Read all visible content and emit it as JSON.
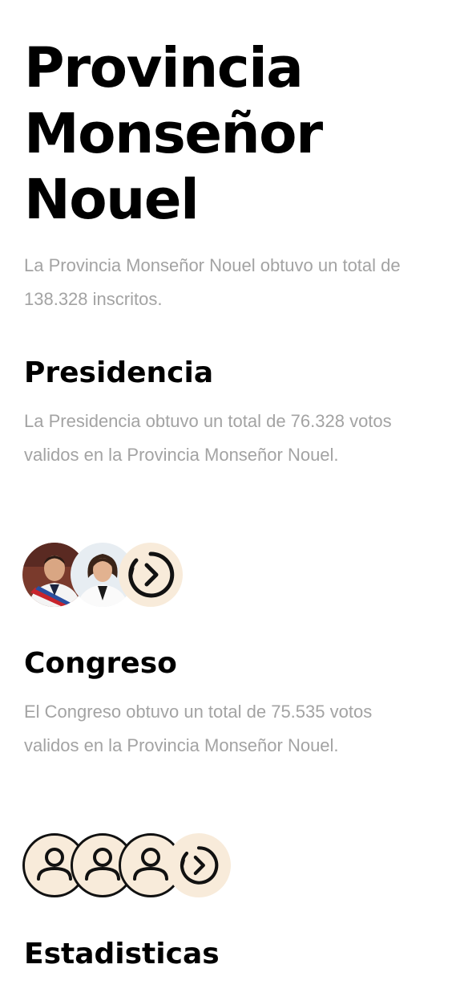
{
  "header": {
    "title": "Provincia Monseñor Nouel",
    "description": "La Provincia Monseñor Nouel obtuvo un total de 138.328 inscritos."
  },
  "presidencia": {
    "title": "Presidencia",
    "description": "La Presidencia obtuvo un total de 76.328 votos validos en la Provincia Monseñor Nouel.",
    "avatars": [
      "candidate-man-photo",
      "candidate-woman-photo"
    ],
    "more_icon": "chevron-right-circle-icon"
  },
  "congreso": {
    "title": "Congreso",
    "description": "El Congreso obtuvo un total de 75.535 votos validos en la Provincia Monseñor Nouel.",
    "avatars": [
      "user-icon",
      "user-icon",
      "user-icon"
    ],
    "more_icon": "chevron-right-circle-icon"
  },
  "estadisticas": {
    "title": "Estadisticas"
  },
  "colors": {
    "accent_bg": "#f8ebda",
    "text_primary": "#000000",
    "text_muted": "#a3a3a3"
  }
}
